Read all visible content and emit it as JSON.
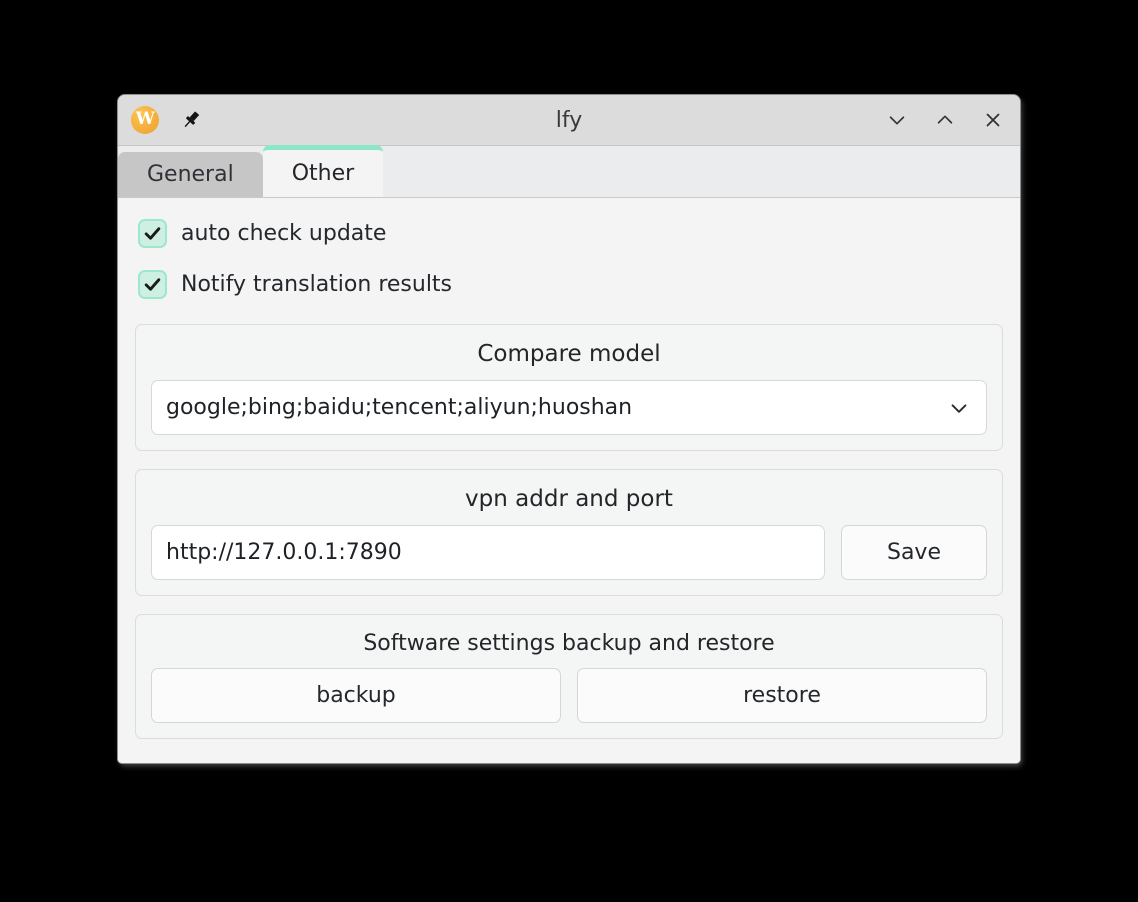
{
  "window": {
    "title": "lfy",
    "app_icon": "app-logo-w-icon",
    "pin_icon": "pin-icon",
    "controls": [
      {
        "name": "minimize-button",
        "icon": "chevron-down-icon"
      },
      {
        "name": "maximize-button",
        "icon": "chevron-up-icon"
      },
      {
        "name": "close-button",
        "icon": "close-icon"
      }
    ]
  },
  "tabs": [
    {
      "label": "General",
      "active": false
    },
    {
      "label": "Other",
      "active": true
    }
  ],
  "options": [
    {
      "label": "auto check update",
      "checked": true
    },
    {
      "label": "Notify translation results",
      "checked": true
    }
  ],
  "compare_model": {
    "title": "Compare model",
    "value": "google;bing;baidu;tencent;aliyun;huoshan",
    "dropdown_icon": "chevron-down-icon"
  },
  "vpn": {
    "title": "vpn addr and port",
    "value": "http://127.0.0.1:7890",
    "placeholder": "http://127.0.0.1:7890",
    "save_label": "Save"
  },
  "backup": {
    "title": "Software settings backup and restore",
    "backup_label": "backup",
    "restore_label": "restore"
  },
  "colors": {
    "accent_green": "#8ce6c8",
    "checkbox_fill": "#cdf0e2",
    "checkbox_border": "#9de8cc",
    "titlebar": "#dcdcdc",
    "content_bg": "#f4f4f4",
    "app_icon": "#f4ac3c",
    "desktop": "#000000"
  }
}
